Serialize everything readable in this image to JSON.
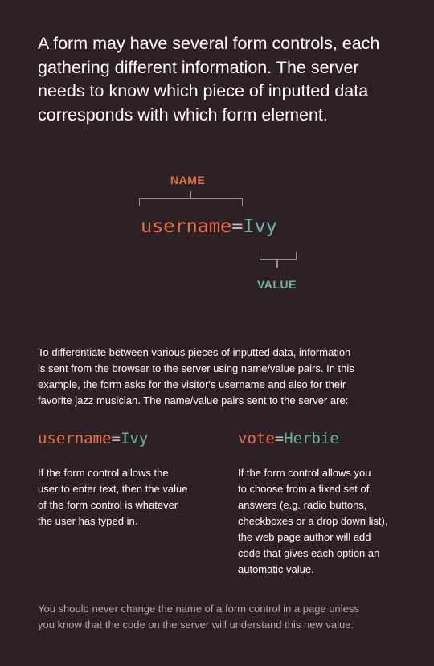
{
  "intro": {
    "lines": [
      "A form may have several form controls, each",
      "gathering different information. The server",
      "needs to know which piece of inputted data",
      "corresponds with which form element."
    ]
  },
  "diagram": {
    "name_label": "NAME",
    "value_label": "VALUE",
    "pair": {
      "name": "username",
      "equals": "=",
      "value": "Ivy"
    }
  },
  "description": {
    "lines": [
      "To differentiate between various pieces of inputted data, information",
      "is sent from the browser to the server using name/value pairs. In this",
      "example, the form asks for the visitor's username and also for their",
      "favorite jazz musician. The name/value pairs sent to the server are:"
    ]
  },
  "examples": [
    {
      "name": "username",
      "equals": "=",
      "value": "Ivy",
      "lines": [
        "If the form control allows the",
        "user to enter text, then the value",
        "of the form control is whatever",
        "the user has typed in."
      ]
    },
    {
      "name": "vote",
      "equals": "=",
      "value": "Herbie",
      "lines": [
        "If the form control allows you",
        "to choose from a fixed set of",
        "answers (e.g. radio buttons,",
        "checkboxes or a drop down list),",
        "the web page author will add",
        "code that gives each option an",
        "automatic value."
      ]
    }
  ],
  "note": {
    "lines": [
      "You should never change the name of a form control in a page unless",
      "you know that the code on the server will understand this new value."
    ]
  },
  "colors": {
    "background": "#2e2125",
    "name": "#e8714c",
    "value": "#6cb3a7",
    "equals": "#bfb8bb",
    "muted": "#b3aaad"
  }
}
